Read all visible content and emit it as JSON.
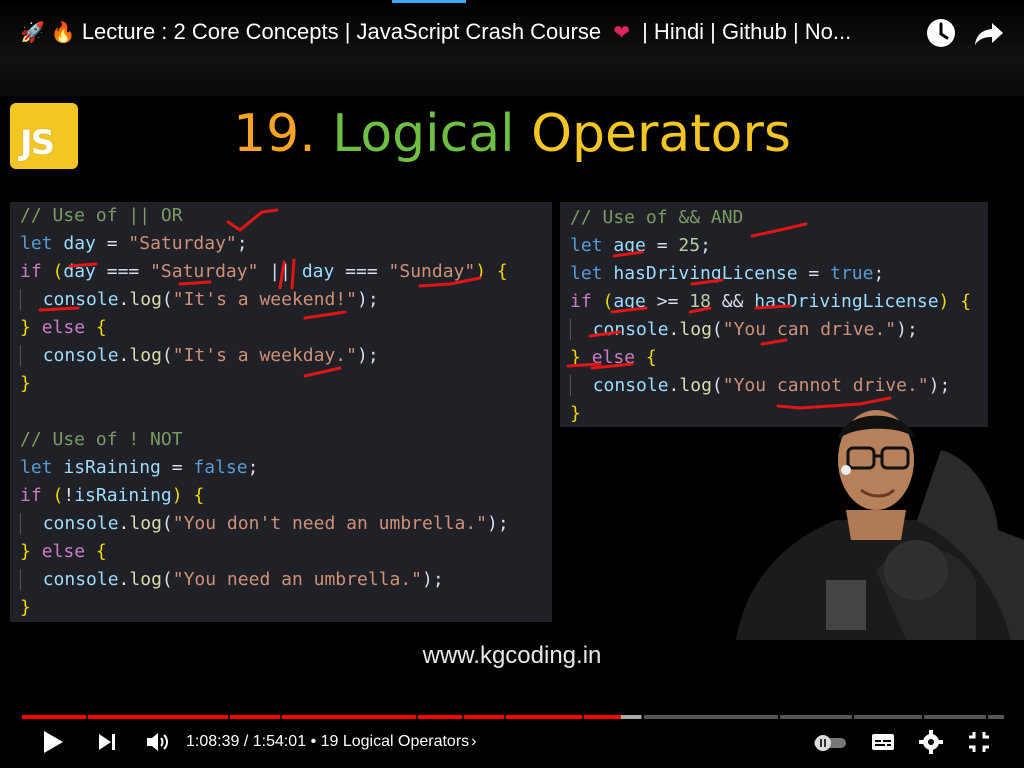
{
  "header": {
    "title": "Lecture : 2 Core Concepts | JavaScript Crash Course",
    "title_rest": "| Hindi | Github | No...",
    "watch_later_icon": "clock-icon",
    "share_icon": "share-arrow-icon"
  },
  "slide": {
    "logo_text": "JS",
    "number": "19.",
    "word1": "Logical",
    "word2": "Operators",
    "site": "www.kgcoding.in"
  },
  "player": {
    "time": "1:08:39 / 1:54:01",
    "chapter": "• 19 Logical Operators",
    "chevron": "›",
    "progress_fraction": 0.61,
    "buffer_fraction": 0.63,
    "colors": {
      "played": "#ff0000",
      "buffered": "#aaaaaa",
      "track": "#555555"
    }
  }
}
